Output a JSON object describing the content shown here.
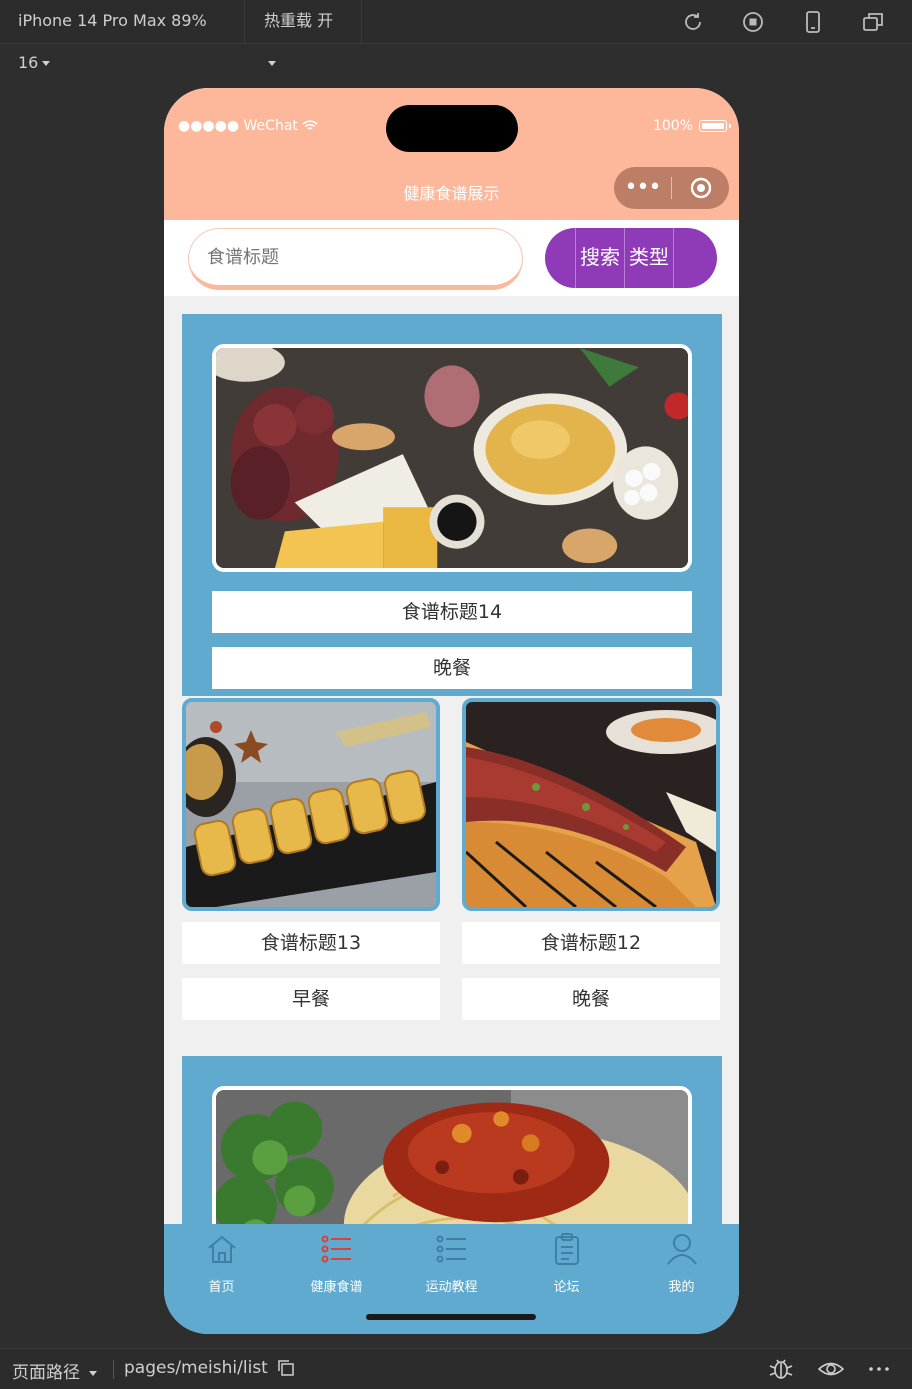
{
  "ide": {
    "device": "iPhone 14 Pro Max 89% 16",
    "hot_reload": "热重载 开",
    "path_label": "页面路径",
    "path_value": "pages/meishi/list"
  },
  "status_bar": {
    "carrier": "●●●●● WeChat",
    "battery": "100%"
  },
  "nav": {
    "title": "健康食谱展示",
    "more": "•••"
  },
  "search": {
    "placeholder": "食谱标题",
    "search_button": "搜索",
    "type_button": "类型"
  },
  "recipes": [
    {
      "title": "食谱标题14",
      "category": "晚餐"
    },
    {
      "title": "食谱标题13",
      "category": "早餐"
    },
    {
      "title": "食谱标题12",
      "category": "晚餐"
    },
    {
      "title": "",
      "category": ""
    }
  ],
  "tabs": [
    {
      "label": "首页",
      "icon": "home-icon"
    },
    {
      "label": "健康食谱",
      "icon": "list-icon",
      "active": true
    },
    {
      "label": "运动教程",
      "icon": "list-icon"
    },
    {
      "label": "论坛",
      "icon": "clipboard-icon"
    },
    {
      "label": "我的",
      "icon": "user-icon"
    }
  ],
  "colors": {
    "header": "#fdb89c",
    "card_blue": "#5faace",
    "button_purple": "#8f3bb8"
  }
}
